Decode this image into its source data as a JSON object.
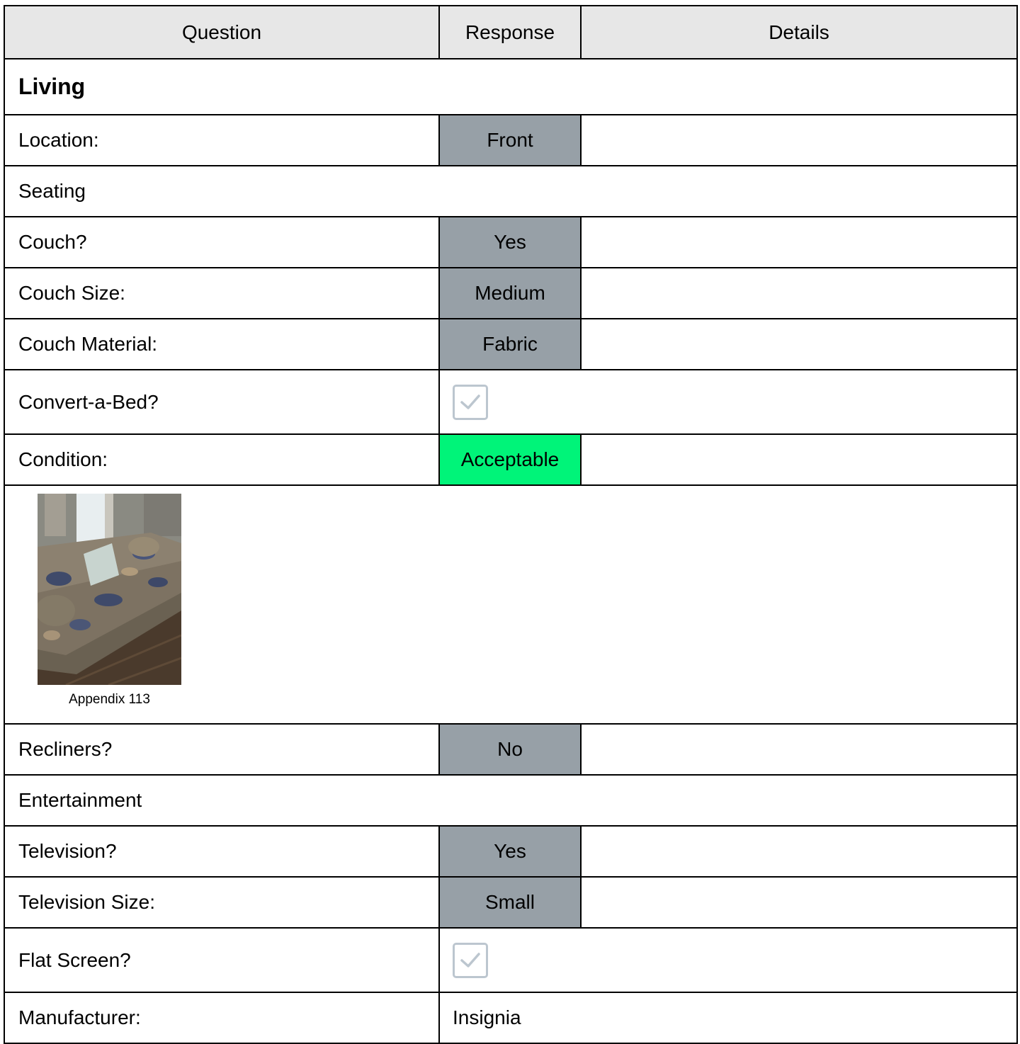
{
  "headers": {
    "question": "Question",
    "response": "Response",
    "details": "Details"
  },
  "section": "Living",
  "location": {
    "label": "Location:",
    "response": "Front"
  },
  "seating": {
    "title": "Seating",
    "couch": {
      "label": "Couch?",
      "response": "Yes"
    },
    "couch_size": {
      "label": "Couch Size:",
      "response": "Medium"
    },
    "couch_material": {
      "label": "Couch Material:",
      "response": "Fabric"
    },
    "convert_a_bed": {
      "label": "Convert-a-Bed?",
      "checked": true,
      "icon": "checkbox-checked-icon"
    },
    "condition": {
      "label": "Condition:",
      "response": "Acceptable",
      "color": "#00f479"
    },
    "photo": {
      "caption": "Appendix 113",
      "description": "photo of floral fabric couch"
    },
    "recliners": {
      "label": "Recliners?",
      "response": "No"
    }
  },
  "entertainment": {
    "title": "Entertainment",
    "television": {
      "label": "Television?",
      "response": "Yes"
    },
    "television_size": {
      "label": "Television Size:",
      "response": "Small"
    },
    "flat_screen": {
      "label": "Flat Screen?",
      "checked": true,
      "icon": "checkbox-checked-icon"
    },
    "manufacturer": {
      "label": "Manufacturer:",
      "response": "Insignia"
    }
  },
  "colors": {
    "header_bg": "#e7e7e7",
    "response_bg": "#97a0a7",
    "acceptable_bg": "#00f479",
    "checkbox_border": "#bcc6cf"
  }
}
